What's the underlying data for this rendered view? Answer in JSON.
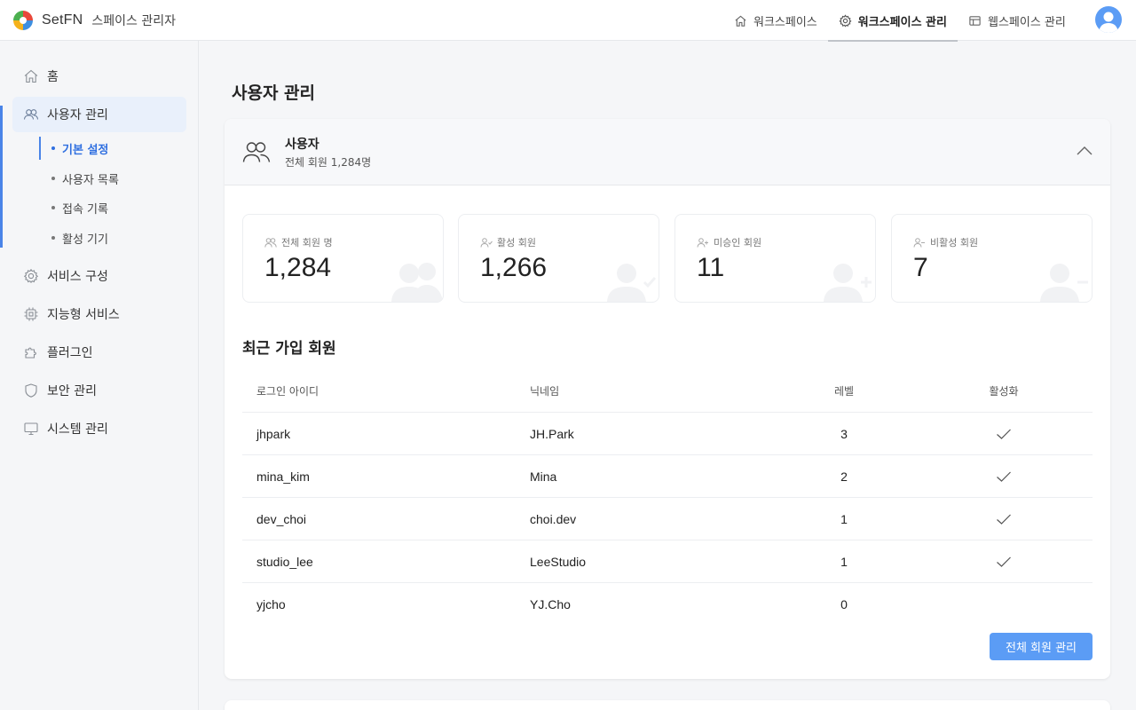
{
  "brand": {
    "name": "SetFN",
    "subtitle": "스페이스 관리자"
  },
  "topnav": [
    {
      "label": "워크스페이스",
      "icon": "home-icon"
    },
    {
      "label": "워크스페이스 관리",
      "icon": "gear-icon",
      "active": true
    },
    {
      "label": "웹스페이스 관리",
      "icon": "layout-icon"
    }
  ],
  "sidebar": {
    "items": [
      {
        "label": "홈",
        "icon": "home-icon"
      },
      {
        "label": "사용자 관리",
        "icon": "users-icon",
        "active": true
      },
      {
        "label": "서비스 구성",
        "icon": "gear-icon"
      },
      {
        "label": "지능형 서비스",
        "icon": "chip-icon"
      },
      {
        "label": "플러그인",
        "icon": "puzzle-icon"
      },
      {
        "label": "보안 관리",
        "icon": "shield-icon"
      },
      {
        "label": "시스템 관리",
        "icon": "monitor-icon"
      }
    ],
    "subitems": [
      {
        "label": "기본 설정",
        "active": true
      },
      {
        "label": "사용자 목록"
      },
      {
        "label": "접속 기록"
      },
      {
        "label": "활성 기기"
      }
    ]
  },
  "page": {
    "title": "사용자 관리"
  },
  "card": {
    "title": "사용자",
    "subtitle": "전체 회원 1,284명",
    "stats": [
      {
        "label": "전체 회원 명",
        "value": "1,284"
      },
      {
        "label": "활성 회원",
        "value": "1,266"
      },
      {
        "label": "미승인 회원",
        "value": "11"
      },
      {
        "label": "비활성 회원",
        "value": "7"
      }
    ],
    "recent_title": "최근 가입 회원",
    "table": {
      "headers": [
        "로그인 아이디",
        "닉네임",
        "레벨",
        "활성화"
      ],
      "rows": [
        {
          "login": "jhpark",
          "nickname": "JH.Park",
          "level": "3",
          "active": true
        },
        {
          "login": "mina_kim",
          "nickname": "Mina",
          "level": "2",
          "active": true
        },
        {
          "login": "dev_choi",
          "nickname": "choi.dev",
          "level": "1",
          "active": true
        },
        {
          "login": "studio_lee",
          "nickname": "LeeStudio",
          "level": "1",
          "active": true
        },
        {
          "login": "yjcho",
          "nickname": "YJ.Cho",
          "level": "0",
          "active": false
        }
      ]
    },
    "manage_button": "전체 회원 관리"
  },
  "colors": {
    "accent": "#4a84e8",
    "button": "#5b9cf5",
    "active_bg": "#e9f0fb"
  }
}
